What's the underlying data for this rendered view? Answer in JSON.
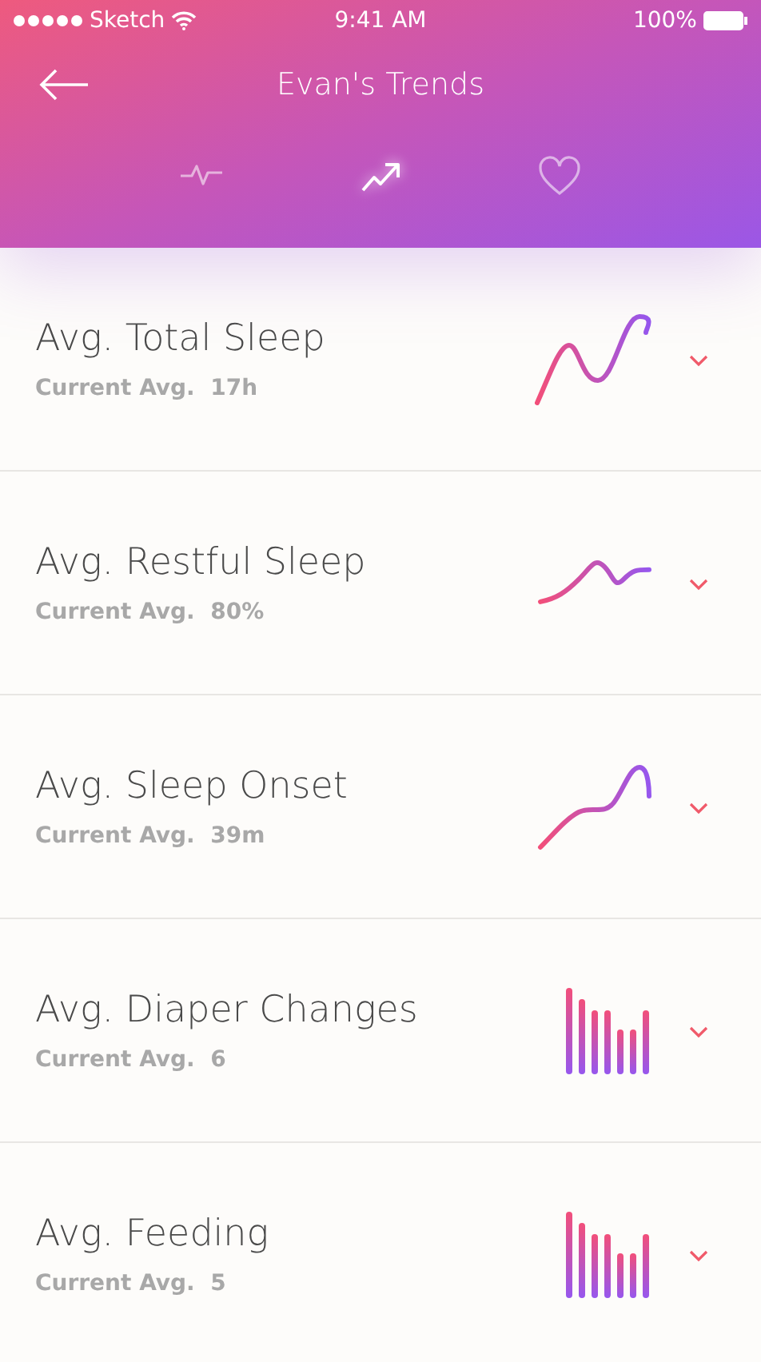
{
  "status_bar": {
    "carrier": "Sketch",
    "time": "9:41 AM",
    "battery": "100%"
  },
  "header": {
    "title": "Evan's Trends"
  },
  "tabs": [
    {
      "selected": false
    },
    {
      "selected": true
    },
    {
      "selected": false
    }
  ],
  "trends": [
    {
      "title": "Avg. Total Sleep",
      "subtitle": "Current Avg.  17h",
      "kind": "line"
    },
    {
      "title": "Avg. Restful Sleep",
      "subtitle": "Current Avg.  80%",
      "kind": "line"
    },
    {
      "title": "Avg. Sleep Onset",
      "subtitle": "Current Avg.  39m",
      "kind": "line"
    },
    {
      "title": "Avg. Diaper Changes",
      "subtitle": "Current Avg.  6",
      "kind": "bars"
    },
    {
      "title": "Avg. Feeding",
      "subtitle": "Current Avg.  5",
      "kind": "bars"
    }
  ]
}
